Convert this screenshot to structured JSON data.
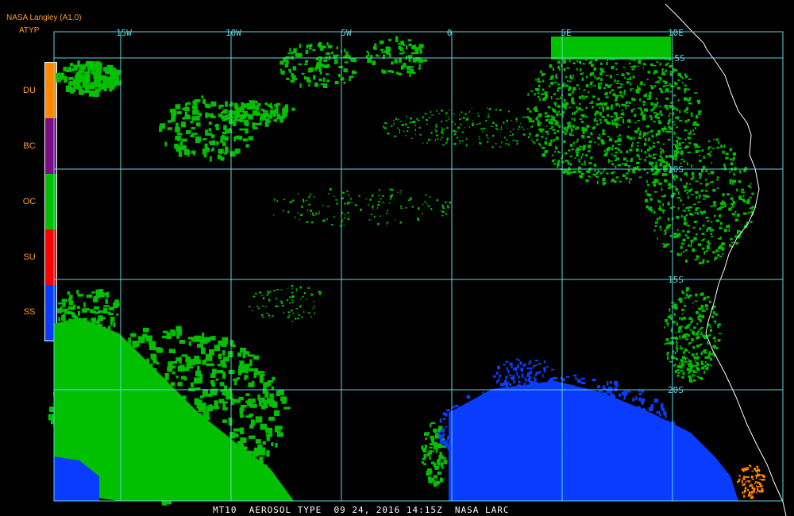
{
  "header": {
    "title": "NASA Langley (A1.0)",
    "product": "ATYP"
  },
  "legend": {
    "items": [
      {
        "code": "DU",
        "color": "#ff8800"
      },
      {
        "code": "BC",
        "color": "#7e0a86"
      },
      {
        "code": "OC",
        "color": "#00c000"
      },
      {
        "code": "SU",
        "color": "#ff0000"
      },
      {
        "code": "SS",
        "color": "#0a3cff"
      }
    ]
  },
  "grid": {
    "longitudes": [
      "15W",
      "10W",
      "5W",
      "0",
      "5E",
      "10E"
    ],
    "latitudes": [
      "5S",
      "10S",
      "15S",
      "20S"
    ],
    "line_color": "#62d6da"
  },
  "footer": {
    "caption": "MT10  AEROSOL TYPE  09 24, 2016 14:15Z  NASA LARC"
  },
  "colors": {
    "background": "#000000",
    "coastline": "#ffffff",
    "oc": "#00c000",
    "ss": "#0a3cff",
    "du": "#ff8800",
    "header_text": "#ff9d2a"
  }
}
